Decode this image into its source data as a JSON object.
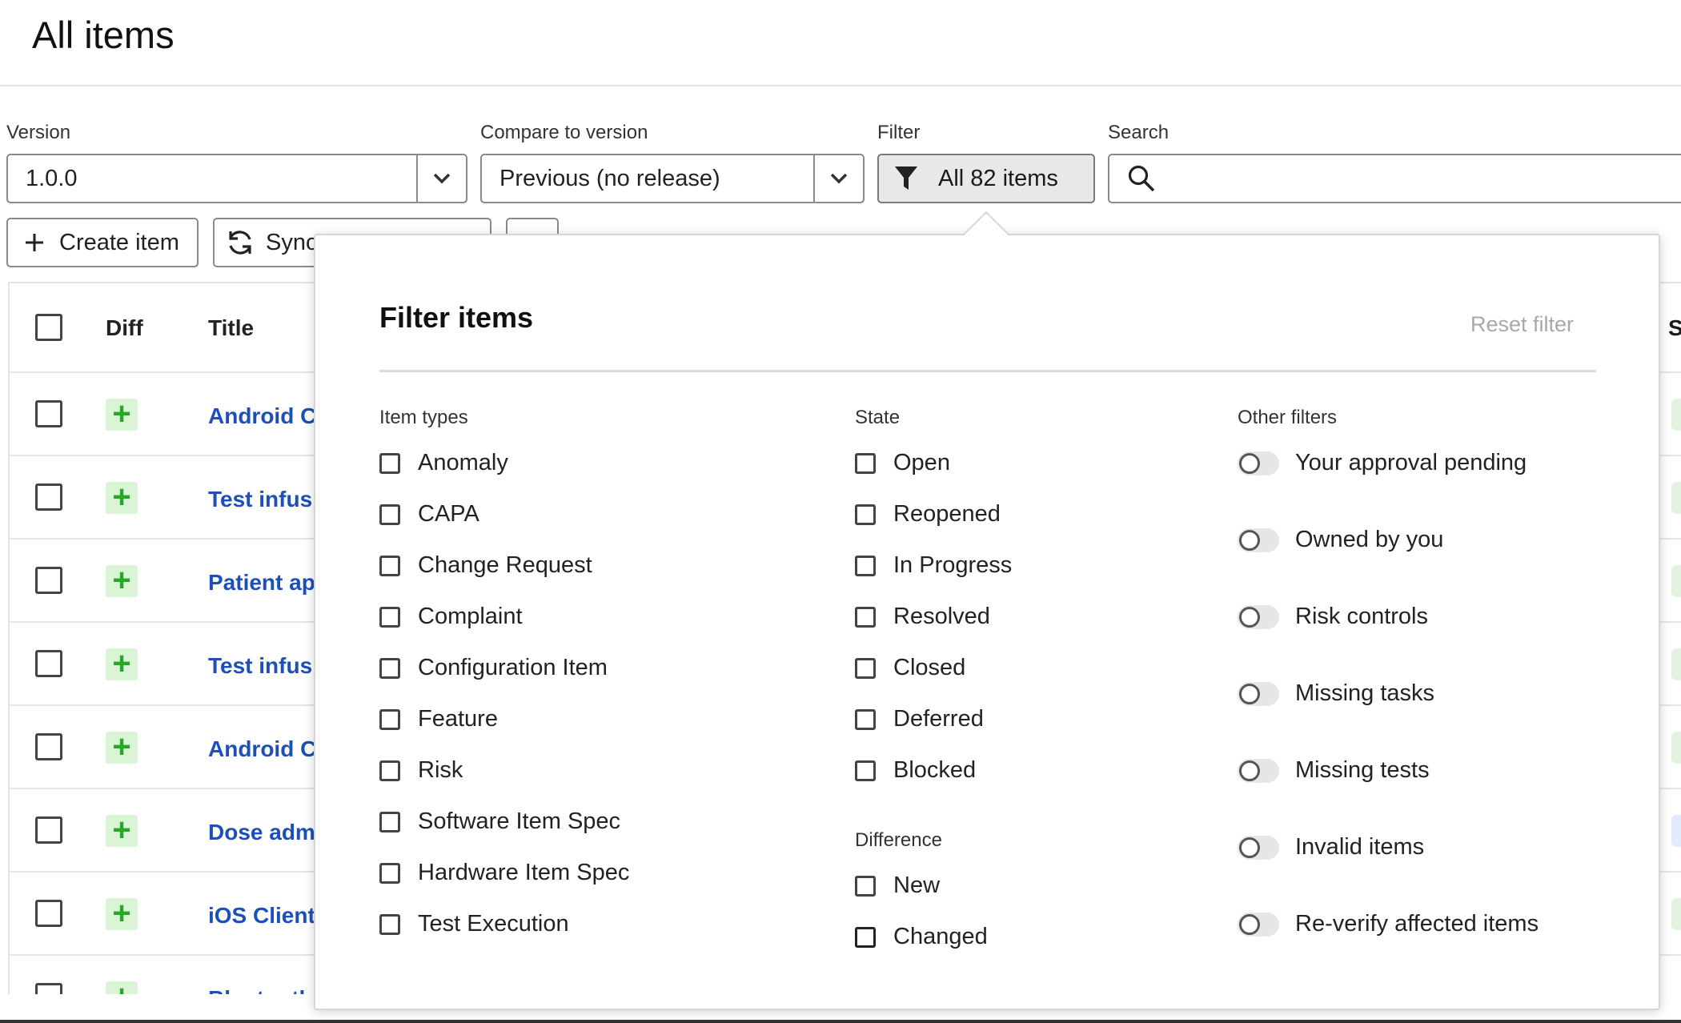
{
  "page": {
    "title": "All items"
  },
  "controls": {
    "version_label": "Version",
    "version_value": "1.0.0",
    "compare_label": "Compare to version",
    "compare_value": "Previous (no release)",
    "filter_label": "Filter",
    "filter_button": "All 82 items",
    "search_label": "Search",
    "create_item": "Create item",
    "sync": "Sync"
  },
  "table": {
    "headers": {
      "diff": "Diff",
      "title": "Title",
      "state_partial": "St"
    },
    "rows": [
      {
        "title": "Android C",
        "diff": "+",
        "state": "green"
      },
      {
        "title": "Test infus",
        "diff": "+",
        "state": "green"
      },
      {
        "title": "Patient ap",
        "diff": "+",
        "state": "green"
      },
      {
        "title": "Test infus",
        "diff": "+",
        "state": "green"
      },
      {
        "title": "Android C",
        "diff": "+",
        "state": "green"
      },
      {
        "title": "Dose adm",
        "diff": "+",
        "state": "blue"
      },
      {
        "title": "iOS Client",
        "diff": "+",
        "state": "green"
      },
      {
        "title": "Bluetooth",
        "diff": "+",
        "state": "green"
      }
    ]
  },
  "filter_popover": {
    "title": "Filter items",
    "reset": "Reset filter",
    "item_types_label": "Item types",
    "item_types": [
      "Anomaly",
      "CAPA",
      "Change Request",
      "Complaint",
      "Configuration Item",
      "Feature",
      "Risk",
      "Software Item Spec",
      "Hardware Item Spec",
      "Test Execution"
    ],
    "state_label": "State",
    "states": [
      "Open",
      "Reopened",
      "In Progress",
      "Resolved",
      "Closed",
      "Deferred",
      "Blocked"
    ],
    "difference_label": "Difference",
    "differences": [
      "New",
      "Changed"
    ],
    "other_label": "Other filters",
    "other_filters": [
      "Your approval pending",
      "Owned by you",
      "Risk controls",
      "Missing tasks",
      "Missing tests",
      "Invalid items",
      "Re-verify affected items"
    ]
  }
}
